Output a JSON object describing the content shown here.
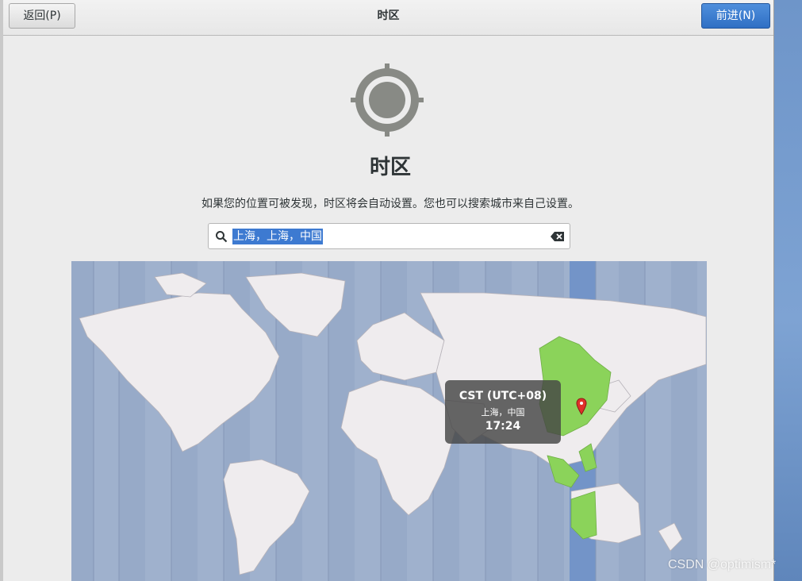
{
  "header": {
    "back_label": "返回(P)",
    "title": "时区",
    "next_label": "前进(N)"
  },
  "page": {
    "title": "时区",
    "description": "如果您的位置可被发现，时区将会自动设置。您也可以搜索城市来自己设置。"
  },
  "search": {
    "value": "上海，上海，中国"
  },
  "map": {
    "highlight_color": "#8bd35a",
    "ocean_color": "#9fb1cd",
    "land_color": "#efecee",
    "selected_band_color": "#6f8ec6",
    "tooltip": {
      "zone": "CST (UTC+08)",
      "city": "上海，中国",
      "time": "17:24"
    }
  },
  "watermark": "CSDN @optimism*",
  "colors": {
    "accent": "#3d7ad1",
    "pin": "#e0302a"
  }
}
